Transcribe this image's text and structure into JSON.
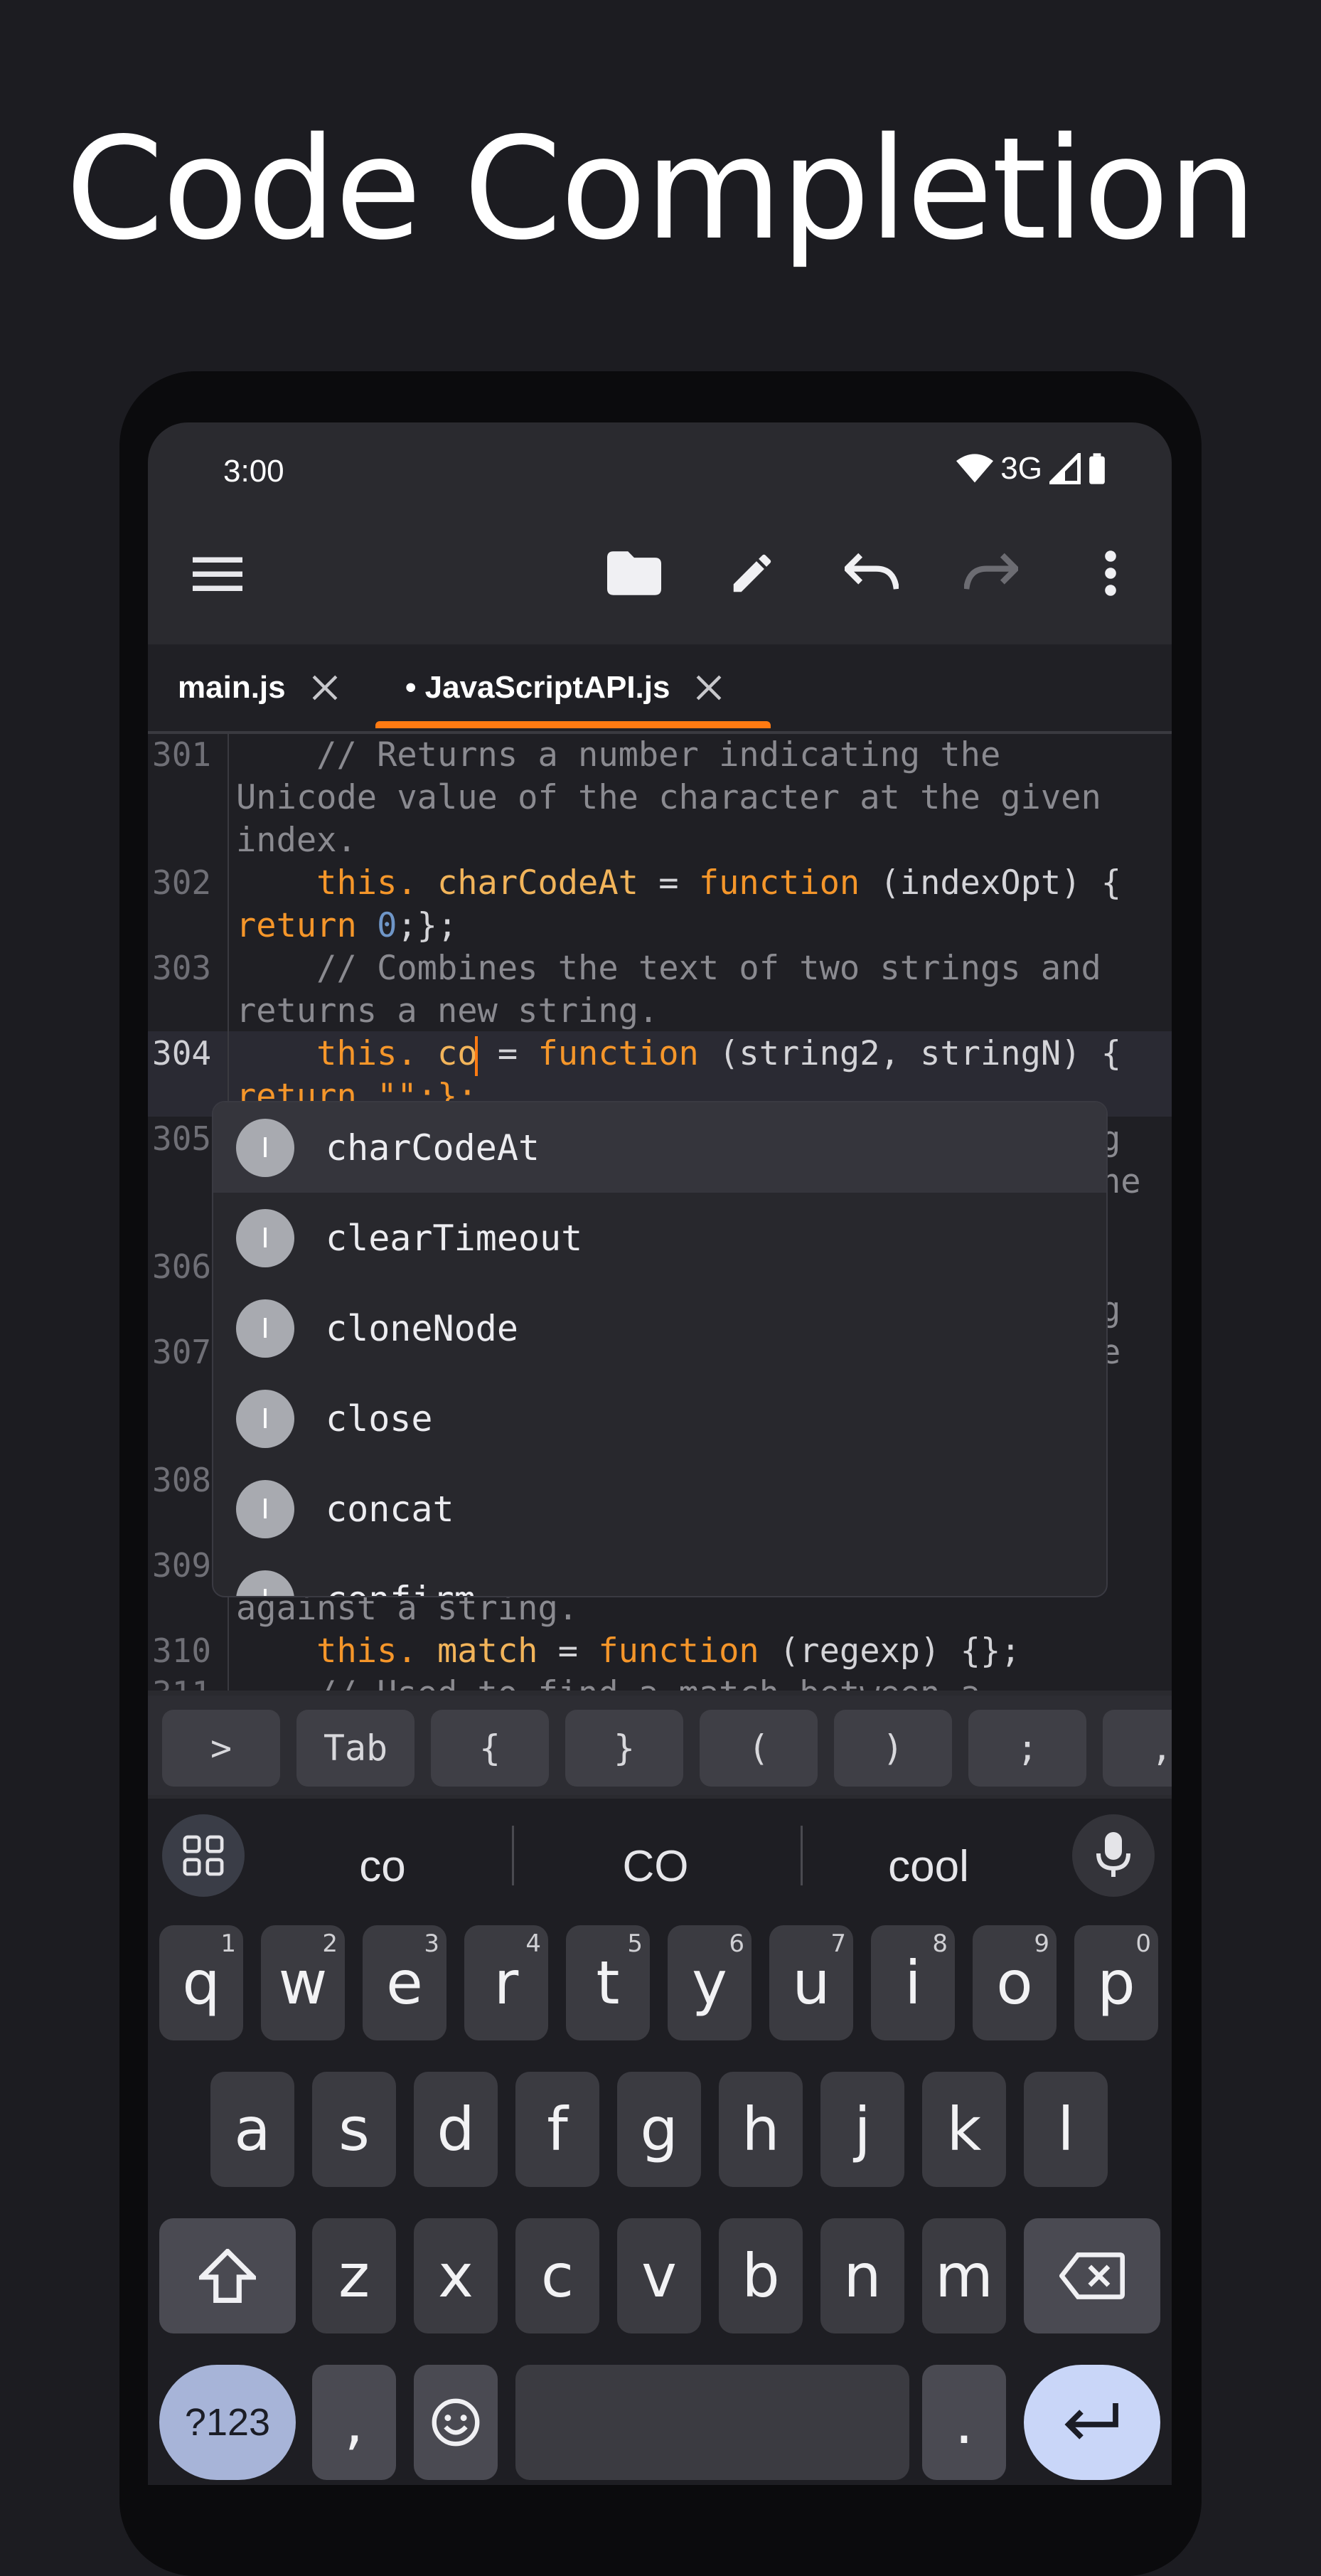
{
  "headline": "Code Completion",
  "status": {
    "time": "3:00",
    "network": "3G"
  },
  "toolbar": {
    "menu_icon": "menu-icon",
    "folder_icon": "folder-icon",
    "edit_icon": "pencil-icon",
    "undo_icon": "undo-icon",
    "redo_icon": "redo-icon",
    "more_icon": "more-vert-icon"
  },
  "tabs": [
    {
      "label": "main.js"
    },
    {
      "label": "• JavaScriptAPI.js"
    }
  ],
  "editor": {
    "line_numbers": [
      "301",
      "302",
      "303",
      "304",
      "305",
      "306",
      "307",
      "308",
      "309",
      "310",
      "311"
    ],
    "l301a": "    // Returns a number indicating the",
    "l301b": "Unicode value of the character at the given",
    "l301c": "index.",
    "l302_this": "    this.",
    "l302_name": " charCodeAt",
    "l302_eq": " = ",
    "l302_fn": "function",
    "l302_rest": " (indexOpt) {",
    "l302b_ret": "return",
    "l302b_num": " 0",
    "l302b_end": ";};",
    "l303a": "    // Combines the text of two strings and",
    "l303b": "returns a new string.",
    "l304_this": "    this.",
    "l304_name": " co",
    "l304_eq": " = ",
    "l304_fn": "function",
    "l304_rest": " (string2, stringN) {",
    "l304b": "return \"\";};",
    "l305_tail1": "g",
    "l305_tail2": "he",
    "l307_tail1": "g",
    "l307_tail2": "e",
    "l309b": "against a string.",
    "l310_this": "    this.",
    "l310_name": " match",
    "l310_eq": " = ",
    "l310_fn": "function",
    "l310_rest": " (regexp) {};",
    "l311a": "    // Used to find a match between a"
  },
  "completion": {
    "badge_letter": "I",
    "items": [
      "charCodeAt",
      "clearTimeout",
      "cloneNode",
      "close",
      "concat",
      "confirm"
    ]
  },
  "symbols": [
    ">",
    "Tab",
    "{",
    "}",
    "(",
    ")",
    ";",
    ","
  ],
  "keyboard": {
    "suggestions": [
      "co",
      "CO",
      "cool"
    ],
    "row1": [
      "q",
      "w",
      "e",
      "r",
      "t",
      "y",
      "u",
      "i",
      "o",
      "p"
    ],
    "row1_sup": [
      "1",
      "2",
      "3",
      "4",
      "5",
      "6",
      "7",
      "8",
      "9",
      "0"
    ],
    "row2": [
      "a",
      "s",
      "d",
      "f",
      "g",
      "h",
      "j",
      "k",
      "l"
    ],
    "row3": [
      "z",
      "x",
      "c",
      "v",
      "b",
      "n",
      "m"
    ],
    "numbers_key": "?123",
    "comma_key": ",",
    "period_key": "."
  }
}
